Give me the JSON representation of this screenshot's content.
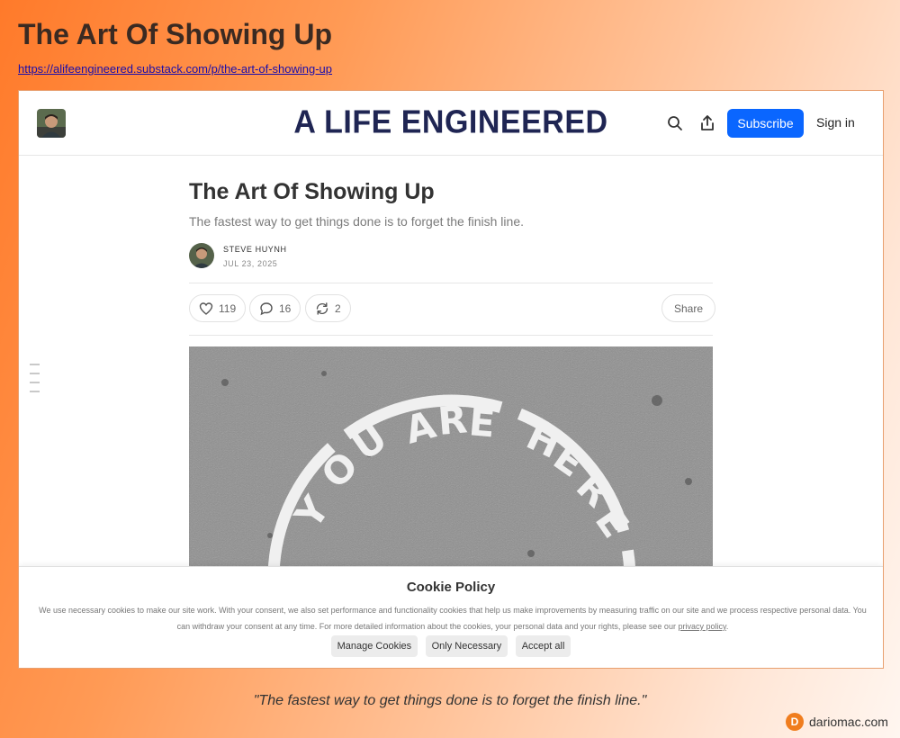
{
  "page": {
    "heading": "The Art Of Showing Up",
    "link": "https://alifeengineered.substack.com/p/the-art-of-showing-up",
    "quote": "\"The fastest way to get things done is to forget the finish line.\"",
    "brand": {
      "badge": "D",
      "name": "dariomac.com",
      "color": "#f07d1e"
    }
  },
  "header": {
    "publication": "A LIFE ENGINEERED",
    "icons": [
      "search-icon",
      "share-icon"
    ],
    "subscribe_label": "Subscribe",
    "signin_label": "Sign in",
    "accent": "#0a66ff"
  },
  "article": {
    "title": "The Art Of Showing Up",
    "subtitle": "The fastest way to get things done is to forget the finish line.",
    "author": "STEVE HUYNH",
    "date": "JUL 23, 2025",
    "likes": "119",
    "comments": "16",
    "restacks": "2",
    "share_label": "Share",
    "hero_alt": "YOU ARE HERE"
  },
  "cookie": {
    "title": "Cookie Policy",
    "text": "We use necessary cookies to make our site work. With your consent, we also set performance and functionality cookies that help us make improvements by measuring traffic on our site and we process respective personal data. You can withdraw your consent at any time. For more detailed information about the cookies, your personal data and your rights, please see our",
    "link_label": "privacy policy",
    "buttons": {
      "manage": "Manage Cookies",
      "necessary": "Only Necessary",
      "accept": "Accept all"
    }
  }
}
